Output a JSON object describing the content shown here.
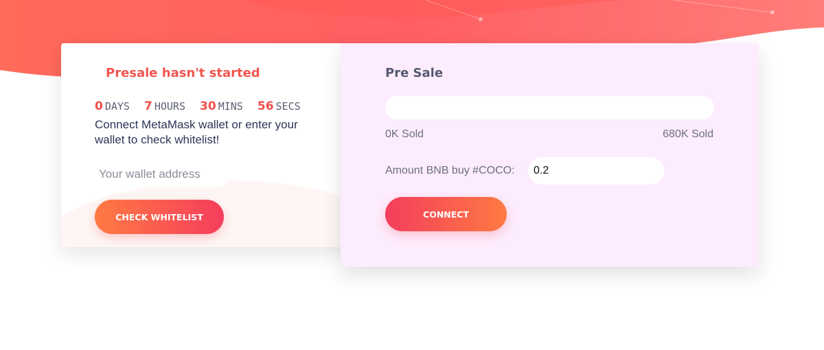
{
  "colors": {
    "accent": "#f2554f",
    "hero_gradient_start": "#ff6a5a",
    "hero_gradient_end": "#ff7d78",
    "presale_card_bg": "#fdecfd",
    "button_gradient_orange": "#ff7a43",
    "button_gradient_pink": "#f53d5d"
  },
  "whitelist": {
    "status": "Presale hasn't started",
    "countdown": {
      "days": "0",
      "days_unit": "DAYS",
      "hours": "7",
      "hours_unit": "HOURS",
      "mins": "30",
      "mins_unit": "MINS",
      "secs": "56",
      "secs_unit": "SECS"
    },
    "instruction": "Connect MetaMask wallet or enter your wallet to check whitelist!",
    "wallet_placeholder": "Your wallet address",
    "wallet_value": "",
    "check_button": "CHECK WHITELIST"
  },
  "presale": {
    "title": "Pre Sale",
    "progress_fraction": 0,
    "sold_min": "0K Sold",
    "sold_max": "680K Sold",
    "amount_label": "Amount BNB buy #COCO:",
    "amount_value": "0.2",
    "connect_button": "CONNECT"
  }
}
